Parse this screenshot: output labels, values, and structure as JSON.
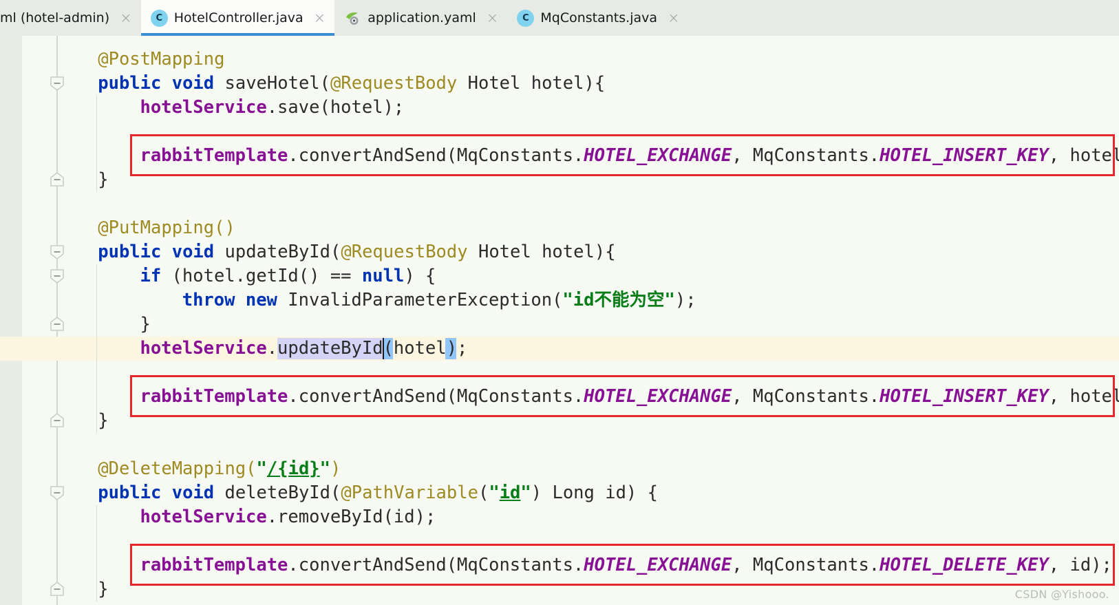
{
  "tabs": [
    {
      "label": "ml (hotel-admin)",
      "icon": "none",
      "active": false,
      "partial": true,
      "close": "×"
    },
    {
      "label": "HotelController.java",
      "icon": "java-class-icon",
      "active": true,
      "partial": false,
      "close": "×"
    },
    {
      "label": "application.yaml",
      "icon": "yaml-file-icon",
      "active": false,
      "partial": false,
      "close": "×"
    },
    {
      "label": "MqConstants.java",
      "icon": "java-class-icon",
      "active": false,
      "partial": false,
      "close": "×"
    }
  ],
  "tab_icon_letter": "C",
  "editor": {
    "language": "java",
    "lines": [
      {
        "indent": 1,
        "segments": [
          {
            "t": "@PostMapping",
            "c": "anno"
          }
        ]
      },
      {
        "indent": 1,
        "segments": [
          {
            "t": "public",
            "c": "kw"
          },
          {
            "t": " ",
            "c": "plain"
          },
          {
            "t": "void",
            "c": "kw"
          },
          {
            "t": " saveHotel(",
            "c": "plain"
          },
          {
            "t": "@RequestBody",
            "c": "anno"
          },
          {
            "t": " Hotel hotel){",
            "c": "plain"
          }
        ]
      },
      {
        "indent": 2,
        "segments": [
          {
            "t": "hotelService",
            "c": "field"
          },
          {
            "t": ".save(hotel);",
            "c": "plain"
          }
        ]
      },
      {
        "indent": 0,
        "segments": []
      },
      {
        "indent": 2,
        "segments": [
          {
            "t": "rabbitTemplate",
            "c": "field"
          },
          {
            "t": ".convertAndSend(MqConstants.",
            "c": "plain"
          },
          {
            "t": "HOTEL_EXCHANGE",
            "c": "cst"
          },
          {
            "t": ", MqConstants.",
            "c": "plain"
          },
          {
            "t": "HOTEL_INSERT_KEY",
            "c": "cst"
          },
          {
            "t": ", hotel.getId());",
            "c": "plain"
          }
        ]
      },
      {
        "indent": 1,
        "segments": [
          {
            "t": "}",
            "c": "plain"
          }
        ]
      },
      {
        "indent": 0,
        "segments": []
      },
      {
        "indent": 1,
        "segments": [
          {
            "t": "@PutMapping()",
            "c": "anno"
          }
        ]
      },
      {
        "indent": 1,
        "segments": [
          {
            "t": "public",
            "c": "kw"
          },
          {
            "t": " ",
            "c": "plain"
          },
          {
            "t": "void",
            "c": "kw"
          },
          {
            "t": " updateById(",
            "c": "plain"
          },
          {
            "t": "@RequestBody",
            "c": "anno"
          },
          {
            "t": " Hotel hotel){",
            "c": "plain"
          }
        ]
      },
      {
        "indent": 2,
        "segments": [
          {
            "t": "if",
            "c": "kw"
          },
          {
            "t": " (hotel.getId() == ",
            "c": "plain"
          },
          {
            "t": "null",
            "c": "kw"
          },
          {
            "t": ") {",
            "c": "plain"
          }
        ]
      },
      {
        "indent": 3,
        "segments": [
          {
            "t": "throw",
            "c": "kw"
          },
          {
            "t": " ",
            "c": "plain"
          },
          {
            "t": "new",
            "c": "kw"
          },
          {
            "t": " InvalidParameterException(",
            "c": "plain"
          },
          {
            "t": "\"id不能为空\"",
            "c": "str"
          },
          {
            "t": ");",
            "c": "plain"
          }
        ]
      },
      {
        "indent": 2,
        "segments": [
          {
            "t": "}",
            "c": "plain"
          }
        ]
      },
      {
        "indent": 2,
        "segments": [
          {
            "t": "hotelService",
            "c": "field"
          },
          {
            "t": ".updateById(hotel);",
            "c": "plain"
          }
        ]
      },
      {
        "indent": 0,
        "segments": []
      },
      {
        "indent": 2,
        "segments": [
          {
            "t": "rabbitTemplate",
            "c": "field"
          },
          {
            "t": ".convertAndSend(MqConstants.",
            "c": "plain"
          },
          {
            "t": "HOTEL_EXCHANGE",
            "c": "cst"
          },
          {
            "t": ", MqConstants.",
            "c": "plain"
          },
          {
            "t": "HOTEL_INSERT_KEY",
            "c": "cst"
          },
          {
            "t": ", hotel.getId());",
            "c": "plain"
          }
        ]
      },
      {
        "indent": 1,
        "segments": [
          {
            "t": "}",
            "c": "plain"
          }
        ]
      },
      {
        "indent": 0,
        "segments": []
      },
      {
        "indent": 1,
        "segments": [
          {
            "t": "@DeleteMapping(",
            "c": "anno"
          },
          {
            "t": "\"",
            "c": "str"
          },
          {
            "t": "/{id}",
            "c": "strpath"
          },
          {
            "t": "\"",
            "c": "str"
          },
          {
            "t": ")",
            "c": "anno"
          }
        ]
      },
      {
        "indent": 1,
        "segments": [
          {
            "t": "public",
            "c": "kw"
          },
          {
            "t": " ",
            "c": "plain"
          },
          {
            "t": "void",
            "c": "kw"
          },
          {
            "t": " deleteById(",
            "c": "plain"
          },
          {
            "t": "@PathVariable",
            "c": "anno"
          },
          {
            "t": "(",
            "c": "plain"
          },
          {
            "t": "\"",
            "c": "str"
          },
          {
            "t": "id",
            "c": "strpath"
          },
          {
            "t": "\"",
            "c": "str"
          },
          {
            "t": ") Long id) {",
            "c": "plain"
          }
        ]
      },
      {
        "indent": 2,
        "segments": [
          {
            "t": "hotelService",
            "c": "field"
          },
          {
            "t": ".removeById(id);",
            "c": "plain"
          }
        ]
      },
      {
        "indent": 0,
        "segments": []
      },
      {
        "indent": 2,
        "segments": [
          {
            "t": "rabbitTemplate",
            "c": "field"
          },
          {
            "t": ".convertAndSend(MqConstants.",
            "c": "plain"
          },
          {
            "t": "HOTEL_EXCHANGE",
            "c": "cst"
          },
          {
            "t": ", MqConstants.",
            "c": "plain"
          },
          {
            "t": "HOTEL_DELETE_KEY",
            "c": "cst"
          },
          {
            "t": ", id);",
            "c": "plain"
          }
        ]
      },
      {
        "indent": 1,
        "segments": [
          {
            "t": "}",
            "c": "plain"
          }
        ]
      }
    ],
    "current_line_index": 12,
    "selection_text": "updateById",
    "brace_match_open": "(",
    "brace_match_close": ")"
  },
  "annotations": {
    "red_boxes": [
      {
        "line_index": 4,
        "label": "post-mapping-send-box"
      },
      {
        "line_index": 14,
        "label": "put-mapping-send-box"
      },
      {
        "line_index": 21,
        "label": "delete-mapping-send-box"
      }
    ]
  },
  "fold_markers": [
    {
      "line_index": 1,
      "dir": "down"
    },
    {
      "line_index": 5,
      "dir": "up"
    },
    {
      "line_index": 8,
      "dir": "down"
    },
    {
      "line_index": 9,
      "dir": "down"
    },
    {
      "line_index": 11,
      "dir": "up"
    },
    {
      "line_index": 15,
      "dir": "up"
    },
    {
      "line_index": 18,
      "dir": "down"
    },
    {
      "line_index": 22,
      "dir": "up"
    }
  ],
  "watermark": "CSDN @Yishooo."
}
